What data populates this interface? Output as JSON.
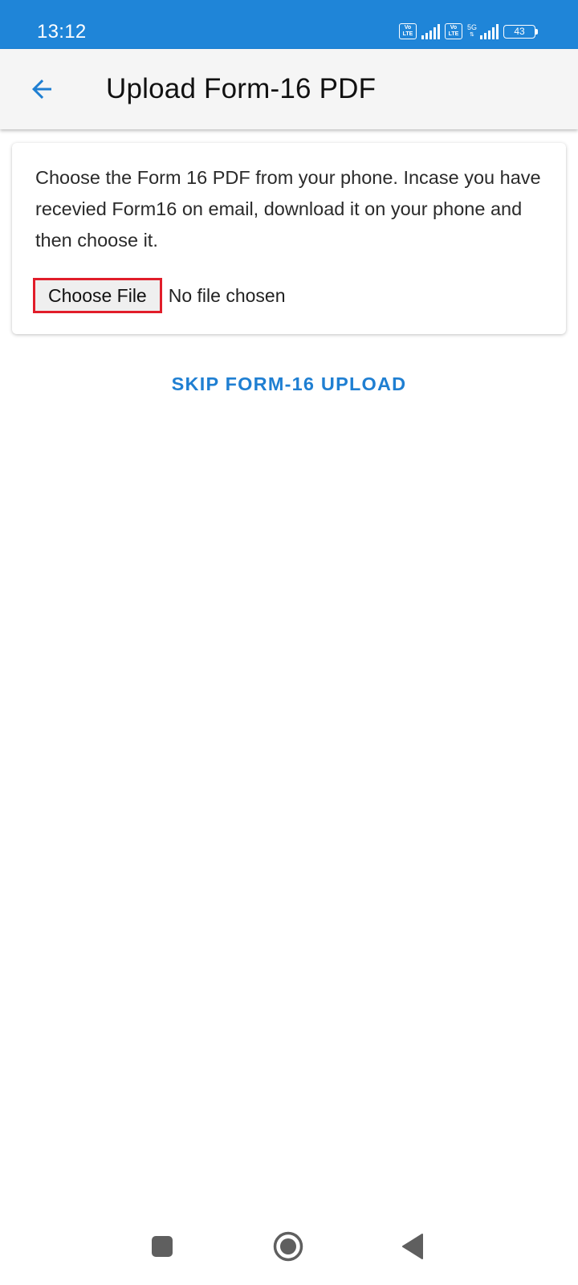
{
  "status_bar": {
    "time": "13:12",
    "volte_label_top": "Vo",
    "volte_label_bottom": "LTE",
    "network_type": "5G",
    "battery_level": "43",
    "icons": [
      "volte-icon",
      "signal-icon",
      "volte-icon",
      "5g-icon",
      "signal-icon",
      "battery-icon"
    ]
  },
  "app_bar": {
    "title": "Upload Form-16 PDF",
    "back_icon": "arrow-left-icon"
  },
  "card": {
    "instruction": "Choose the Form 16 PDF from your phone. Incase you have recevied Form16 on email, download it on your phone and then choose it.",
    "choose_file_label": "Choose File",
    "file_status": "No file chosen"
  },
  "skip": {
    "label": "SKIP FORM-16 UPLOAD"
  },
  "colors": {
    "status_bar": "#1f85d8",
    "accent": "#1f7fd2",
    "highlight_border": "#e11d2a",
    "app_bar": "#f5f5f5"
  },
  "nav_bar": {
    "icons": [
      "square-recents-icon",
      "circle-home-icon",
      "triangle-back-icon"
    ]
  }
}
